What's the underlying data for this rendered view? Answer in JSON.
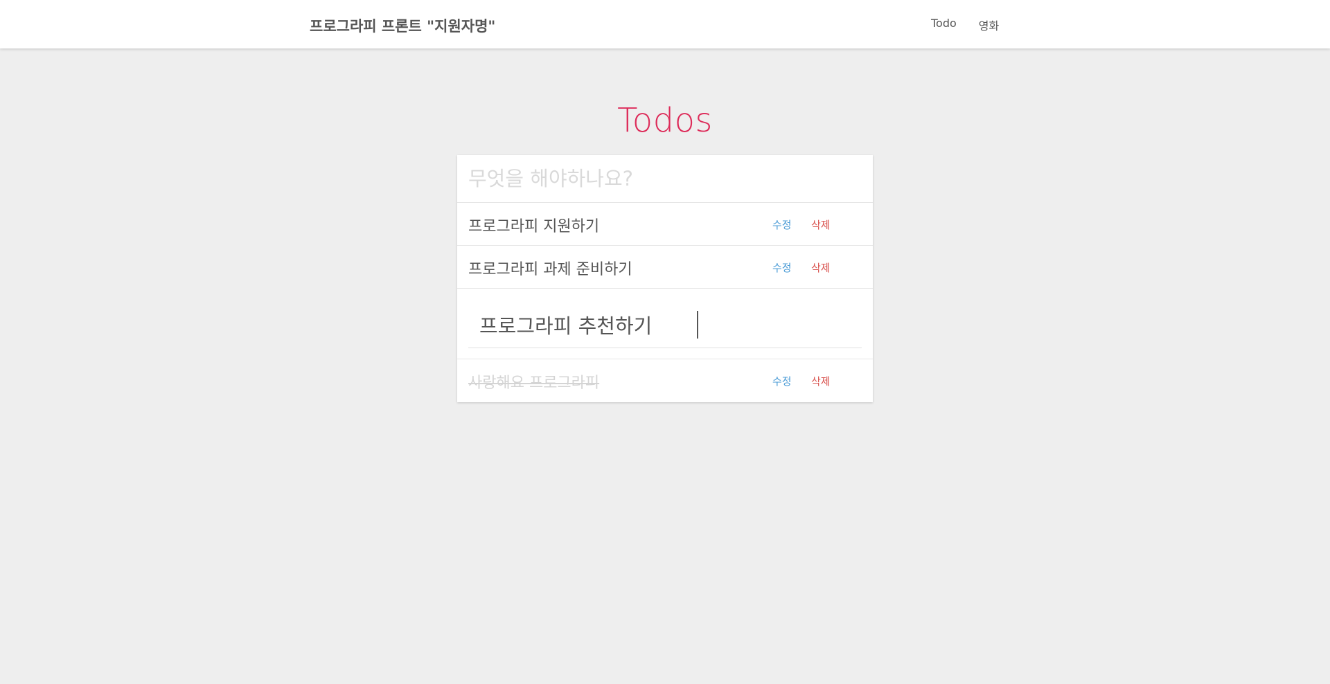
{
  "navbar": {
    "brand": "프로그라피 프론트 \"지원자명\"",
    "links": [
      "Todo",
      "영화"
    ]
  },
  "page": {
    "title": "Todos"
  },
  "new_todo": {
    "placeholder": "무엇을 해야하나요?",
    "value": ""
  },
  "todos": [
    {
      "text": "프로그라피 지원하기",
      "completed": false,
      "edit_label": "수정",
      "delete_label": "삭제"
    },
    {
      "text": "프로그라피 과제 준비하기",
      "completed": false,
      "edit_label": "수정",
      "delete_label": "삭제"
    },
    {
      "text": "프로그라피 추천하기",
      "editing": true
    },
    {
      "text": "사랑해요 프로그라피",
      "completed": true,
      "edit_label": "수정",
      "delete_label": "삭제"
    }
  ],
  "colors": {
    "title": "#dd2c5a",
    "edit": "#4a9bd6",
    "delete": "#d9534f",
    "background": "#eeeeee"
  }
}
